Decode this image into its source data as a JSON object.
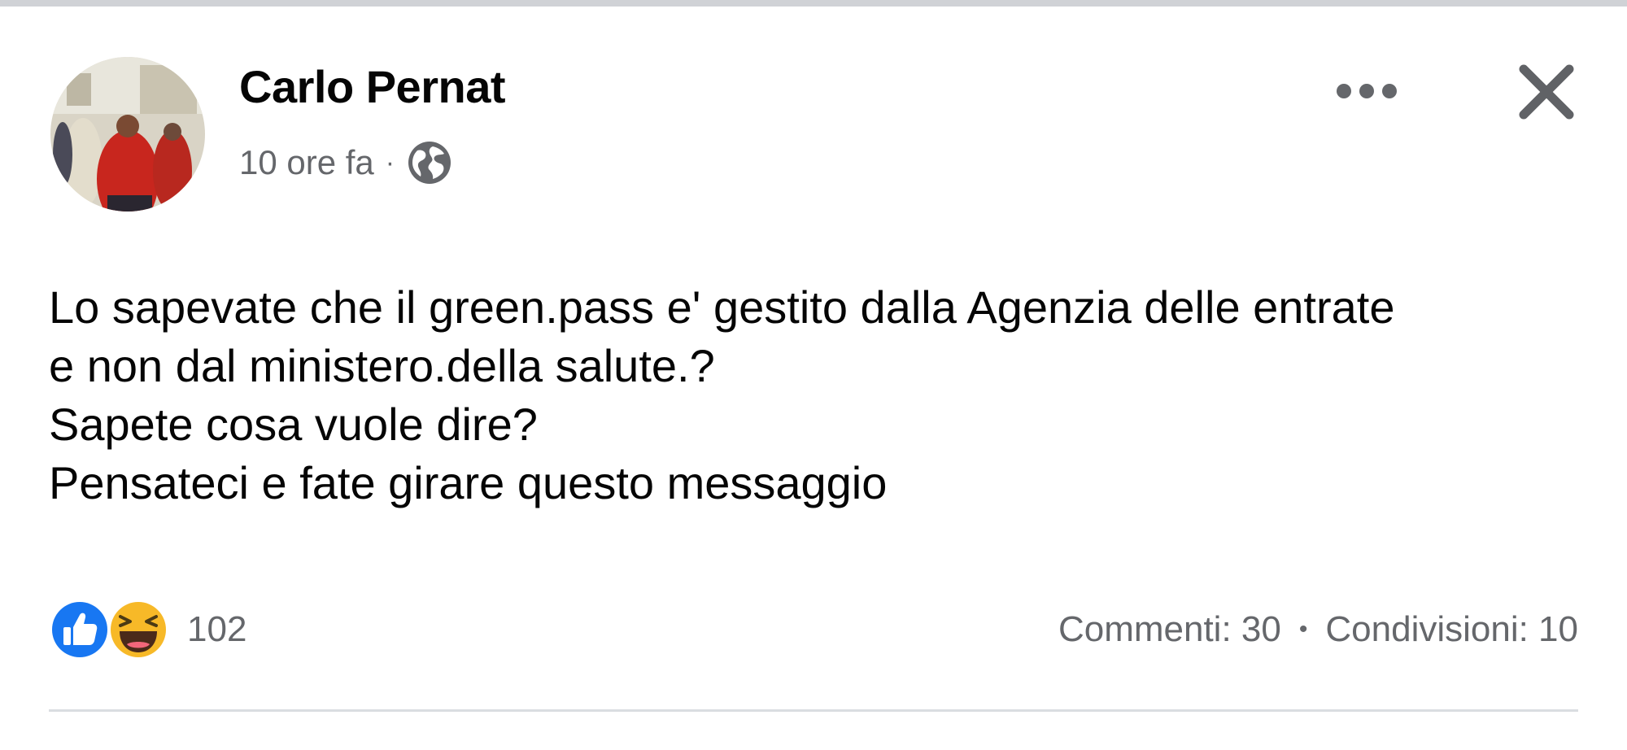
{
  "post": {
    "author": "Carlo Pernat",
    "timestamp": "10 ore fa",
    "meta_separator": "·",
    "privacy_icon": "globe-icon",
    "message_lines": [
      "Lo sapevate che il green.pass e' gestito dalla Agenzia delle entrate",
      "e non dal ministero.della salute.?",
      "Sapete cosa vuole dire?",
      "Pensateci e fate girare questo messaggio"
    ]
  },
  "reactions": {
    "icons": [
      "like-icon",
      "haha-icon"
    ],
    "count": "102"
  },
  "stats": {
    "comments": "Commenti: 30",
    "separator": "•",
    "shares": "Condivisioni: 10"
  },
  "colors": {
    "text_primary": "#050505",
    "text_secondary": "#65676b",
    "like_blue": "#1877f2",
    "haha_yellow": "#f7b928"
  }
}
